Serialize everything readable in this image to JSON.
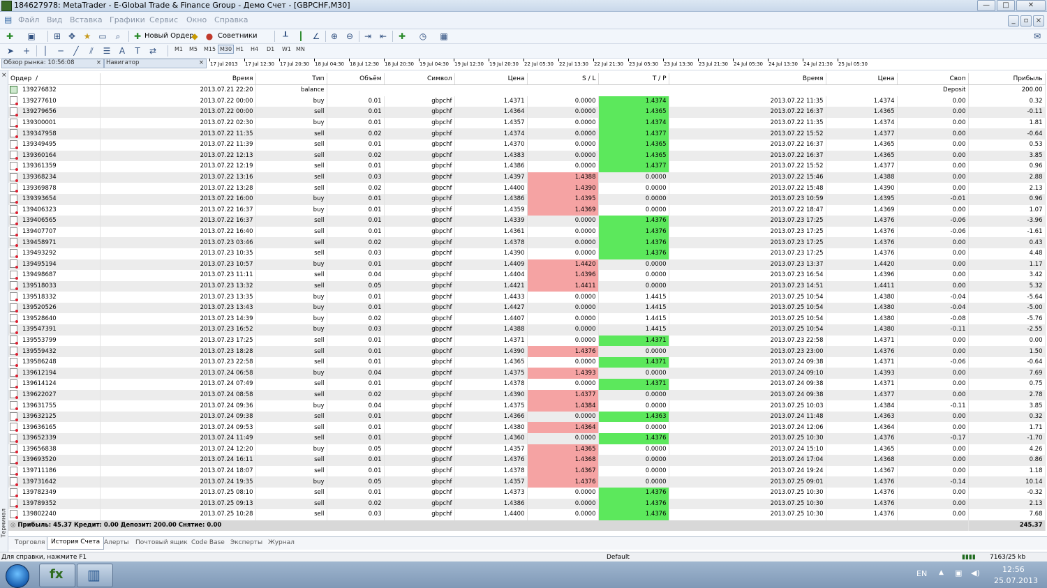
{
  "window": {
    "title": "184627978: MetaTrader - E-Global Trade & Finance Group - Демо Счет - [GBPCHF,M30]"
  },
  "menu": [
    "Файл",
    "Вид",
    "Вставка",
    "Графики",
    "Сервис",
    "Окно",
    "Справка"
  ],
  "toolbar": {
    "new_order": "Новый Ордер",
    "experts": "Советники"
  },
  "timeframes": [
    "M1",
    "M5",
    "M15",
    "M30",
    "H1",
    "H4",
    "D1",
    "W1",
    "MN"
  ],
  "side_panels": {
    "market_watch": "Обзор рынка: 10:56:08",
    "navigator": "Навигатор"
  },
  "chart_time_labels": [
    "17 Jul 2013",
    "17 Jul 12:30",
    "17 Jul 20:30",
    "18 Jul 04:30",
    "18 Jul 12:30",
    "18 Jul 20:30",
    "19 Jul 04:30",
    "19 Jul 12:30",
    "19 Jul 20:30",
    "22 Jul 05:30",
    "22 Jul 13:30",
    "22 Jul 21:30",
    "23 Jul 05:30",
    "23 Jul 13:30",
    "23 Jul 21:30",
    "24 Jul 05:30",
    "24 Jul 13:30",
    "24 Jul 21:30",
    "25 Jul 05:30"
  ],
  "table": {
    "headers": [
      "Ордер",
      "Время",
      "Тип",
      "Объём",
      "Символ",
      "Цена",
      "S / L",
      "T / P",
      "Время",
      "Цена",
      "Своп",
      "Прибыль"
    ],
    "balance_row": {
      "order": "139276832",
      "time": "2013.07.21 22:20",
      "type": "balance",
      "comment": "Deposit",
      "profit": "200.00"
    },
    "rows": [
      [
        "139277610",
        "2013.07.22 00:00",
        "buy",
        "0.01",
        "gbpchf",
        "1.4371",
        "0.0000",
        "1.4374",
        "2013.07.22 11:35",
        "1.4374",
        "0.00",
        "0.32"
      ],
      [
        "139279656",
        "2013.07.22 00:00",
        "sell",
        "0.01",
        "gbpchf",
        "1.4364",
        "0.0000",
        "1.4365",
        "2013.07.22 16:37",
        "1.4365",
        "0.00",
        "-0.11"
      ],
      [
        "139300001",
        "2013.07.22 02:30",
        "buy",
        "0.01",
        "gbpchf",
        "1.4357",
        "0.0000",
        "1.4374",
        "2013.07.22 11:35",
        "1.4374",
        "0.00",
        "1.81"
      ],
      [
        "139347958",
        "2013.07.22 11:35",
        "sell",
        "0.02",
        "gbpchf",
        "1.4374",
        "0.0000",
        "1.4377",
        "2013.07.22 15:52",
        "1.4377",
        "0.00",
        "-0.64"
      ],
      [
        "139349495",
        "2013.07.22 11:39",
        "sell",
        "0.01",
        "gbpchf",
        "1.4370",
        "0.0000",
        "1.4365",
        "2013.07.22 16:37",
        "1.4365",
        "0.00",
        "0.53"
      ],
      [
        "139360164",
        "2013.07.22 12:13",
        "sell",
        "0.02",
        "gbpchf",
        "1.4383",
        "0.0000",
        "1.4365",
        "2013.07.22 16:37",
        "1.4365",
        "0.00",
        "3.85"
      ],
      [
        "139361359",
        "2013.07.22 12:19",
        "sell",
        "0.01",
        "gbpchf",
        "1.4386",
        "0.0000",
        "1.4377",
        "2013.07.22 15:52",
        "1.4377",
        "0.00",
        "0.96"
      ],
      [
        "139368234",
        "2013.07.22 13:16",
        "sell",
        "0.03",
        "gbpchf",
        "1.4397",
        "1.4388",
        "0.0000",
        "2013.07.22 15:46",
        "1.4388",
        "0.00",
        "2.88"
      ],
      [
        "139369878",
        "2013.07.22 13:28",
        "sell",
        "0.02",
        "gbpchf",
        "1.4400",
        "1.4390",
        "0.0000",
        "2013.07.22 15:48",
        "1.4390",
        "0.00",
        "2.13"
      ],
      [
        "139393654",
        "2013.07.22 16:00",
        "buy",
        "0.01",
        "gbpchf",
        "1.4386",
        "1.4395",
        "0.0000",
        "2013.07.23 10:59",
        "1.4395",
        "-0.01",
        "0.96"
      ],
      [
        "139406323",
        "2013.07.22 16:37",
        "buy",
        "0.01",
        "gbpchf",
        "1.4359",
        "1.4369",
        "0.0000",
        "2013.07.22 18:47",
        "1.4369",
        "0.00",
        "1.07"
      ],
      [
        "139406565",
        "2013.07.22 16:37",
        "sell",
        "0.01",
        "gbpchf",
        "1.4339",
        "0.0000",
        "1.4376",
        "2013.07.23 17:25",
        "1.4376",
        "-0.06",
        "-3.96"
      ],
      [
        "139407707",
        "2013.07.22 16:40",
        "sell",
        "0.01",
        "gbpchf",
        "1.4361",
        "0.0000",
        "1.4376",
        "2013.07.23 17:25",
        "1.4376",
        "-0.06",
        "-1.61"
      ],
      [
        "139458971",
        "2013.07.23 03:46",
        "sell",
        "0.02",
        "gbpchf",
        "1.4378",
        "0.0000",
        "1.4376",
        "2013.07.23 17:25",
        "1.4376",
        "0.00",
        "0.43"
      ],
      [
        "139493292",
        "2013.07.23 10:35",
        "sell",
        "0.03",
        "gbpchf",
        "1.4390",
        "0.0000",
        "1.4376",
        "2013.07.23 17:25",
        "1.4376",
        "0.00",
        "4.48"
      ],
      [
        "139495194",
        "2013.07.23 10:57",
        "buy",
        "0.01",
        "gbpchf",
        "1.4409",
        "1.4420",
        "0.0000",
        "2013.07.23 13:37",
        "1.4420",
        "0.00",
        "1.17"
      ],
      [
        "139498687",
        "2013.07.23 11:11",
        "sell",
        "0.04",
        "gbpchf",
        "1.4404",
        "1.4396",
        "0.0000",
        "2013.07.23 16:54",
        "1.4396",
        "0.00",
        "3.42"
      ],
      [
        "139518033",
        "2013.07.23 13:32",
        "sell",
        "0.05",
        "gbpchf",
        "1.4421",
        "1.4411",
        "0.0000",
        "2013.07.23 14:51",
        "1.4411",
        "0.00",
        "5.32"
      ],
      [
        "139518332",
        "2013.07.23 13:35",
        "buy",
        "0.01",
        "gbpchf",
        "1.4433",
        "0.0000",
        "1.4415",
        "2013.07.25 10:54",
        "1.4380",
        "-0.04",
        "-5.64"
      ],
      [
        "139520526",
        "2013.07.23 13:43",
        "buy",
        "0.01",
        "gbpchf",
        "1.4427",
        "0.0000",
        "1.4415",
        "2013.07.25 10:54",
        "1.4380",
        "-0.04",
        "-5.00"
      ],
      [
        "139528640",
        "2013.07.23 14:39",
        "buy",
        "0.02",
        "gbpchf",
        "1.4407",
        "0.0000",
        "1.4415",
        "2013.07.25 10:54",
        "1.4380",
        "-0.08",
        "-5.76"
      ],
      [
        "139547391",
        "2013.07.23 16:52",
        "buy",
        "0.03",
        "gbpchf",
        "1.4388",
        "0.0000",
        "1.4415",
        "2013.07.25 10:54",
        "1.4380",
        "-0.11",
        "-2.55"
      ],
      [
        "139553799",
        "2013.07.23 17:25",
        "sell",
        "0.01",
        "gbpchf",
        "1.4371",
        "0.0000",
        "1.4371",
        "2013.07.23 22:58",
        "1.4371",
        "0.00",
        "0.00"
      ],
      [
        "139559432",
        "2013.07.23 18:28",
        "sell",
        "0.01",
        "gbpchf",
        "1.4390",
        "1.4376",
        "0.0000",
        "2013.07.23 23:00",
        "1.4376",
        "0.00",
        "1.50"
      ],
      [
        "139586248",
        "2013.07.23 22:58",
        "sell",
        "0.01",
        "gbpchf",
        "1.4365",
        "0.0000",
        "1.4371",
        "2013.07.24 09:38",
        "1.4371",
        "-0.06",
        "-0.64"
      ],
      [
        "139612194",
        "2013.07.24 06:58",
        "buy",
        "0.04",
        "gbpchf",
        "1.4375",
        "1.4393",
        "0.0000",
        "2013.07.24 09:10",
        "1.4393",
        "0.00",
        "7.69"
      ],
      [
        "139614124",
        "2013.07.24 07:49",
        "sell",
        "0.01",
        "gbpchf",
        "1.4378",
        "0.0000",
        "1.4371",
        "2013.07.24 09:38",
        "1.4371",
        "0.00",
        "0.75"
      ],
      [
        "139622027",
        "2013.07.24 08:58",
        "sell",
        "0.02",
        "gbpchf",
        "1.4390",
        "1.4377",
        "0.0000",
        "2013.07.24 09:38",
        "1.4377",
        "0.00",
        "2.78"
      ],
      [
        "139631755",
        "2013.07.24 09:36",
        "buy",
        "0.04",
        "gbpchf",
        "1.4375",
        "1.4384",
        "0.0000",
        "2013.07.25 10:03",
        "1.4384",
        "-0.11",
        "3.85"
      ],
      [
        "139632125",
        "2013.07.24 09:38",
        "sell",
        "0.01",
        "gbpchf",
        "1.4366",
        "0.0000",
        "1.4363",
        "2013.07.24 11:48",
        "1.4363",
        "0.00",
        "0.32"
      ],
      [
        "139636165",
        "2013.07.24 09:53",
        "sell",
        "0.01",
        "gbpchf",
        "1.4380",
        "1.4364",
        "0.0000",
        "2013.07.24 12:06",
        "1.4364",
        "0.00",
        "1.71"
      ],
      [
        "139652339",
        "2013.07.24 11:49",
        "sell",
        "0.01",
        "gbpchf",
        "1.4360",
        "0.0000",
        "1.4376",
        "2013.07.25 10:30",
        "1.4376",
        "-0.17",
        "-1.70"
      ],
      [
        "139656838",
        "2013.07.24 12:20",
        "buy",
        "0.05",
        "gbpchf",
        "1.4357",
        "1.4365",
        "0.0000",
        "2013.07.24 15:10",
        "1.4365",
        "0.00",
        "4.26"
      ],
      [
        "139693520",
        "2013.07.24 16:11",
        "sell",
        "0.01",
        "gbpchf",
        "1.4376",
        "1.4368",
        "0.0000",
        "2013.07.24 17:04",
        "1.4368",
        "0.00",
        "0.86"
      ],
      [
        "139711186",
        "2013.07.24 18:07",
        "sell",
        "0.01",
        "gbpchf",
        "1.4378",
        "1.4367",
        "0.0000",
        "2013.07.24 19:24",
        "1.4367",
        "0.00",
        "1.18"
      ],
      [
        "139731642",
        "2013.07.24 19:35",
        "buy",
        "0.05",
        "gbpchf",
        "1.4357",
        "1.4376",
        "0.0000",
        "2013.07.25 09:01",
        "1.4376",
        "-0.14",
        "10.14"
      ],
      [
        "139782349",
        "2013.07.25 08:10",
        "sell",
        "0.01",
        "gbpchf",
        "1.4373",
        "0.0000",
        "1.4376",
        "2013.07.25 10:30",
        "1.4376",
        "0.00",
        "-0.32"
      ],
      [
        "139789352",
        "2013.07.25 09:13",
        "sell",
        "0.02",
        "gbpchf",
        "1.4386",
        "0.0000",
        "1.4376",
        "2013.07.25 10:30",
        "1.4376",
        "0.00",
        "2.13"
      ],
      [
        "139802240",
        "2013.07.25 10:28",
        "sell",
        "0.03",
        "gbpchf",
        "1.4400",
        "0.0000",
        "1.4376",
        "2013.07.25 10:30",
        "1.4376",
        "0.00",
        "7.68"
      ]
    ],
    "summary": {
      "text": "Прибыль: 45.37  Кредит: 0.00  Депозит: 200.00  Снятие: 0.00",
      "total": "245.37"
    }
  },
  "terminal_label": "Терминал",
  "tabs": [
    "Торговля",
    "История Счета",
    "Алерты",
    "Почтовый ящик",
    "Code Base",
    "Эксперты",
    "Журнал"
  ],
  "active_tab": "История Счета",
  "status": {
    "help": "Для справки, нажмите F1",
    "profile": "Default",
    "traffic": "7163/25 kb"
  },
  "tray": {
    "lang": "EN",
    "time": "12:56",
    "date": "25.07.2013"
  },
  "colors": {
    "sl_hit": "#f5a3a3",
    "tp_hit": "#5ce85c"
  }
}
